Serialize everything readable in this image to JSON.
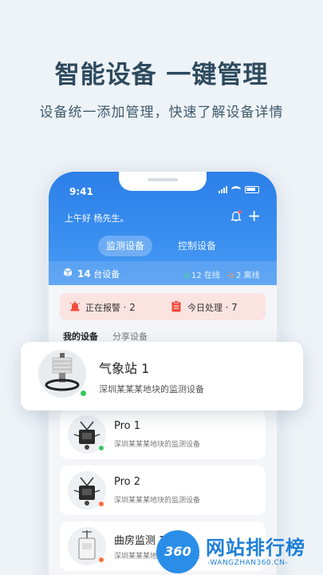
{
  "headline": "智能设备 一键管理",
  "subheadline": "设备统一添加管理，快速了解设备详情",
  "status_bar": {
    "time": "9:41"
  },
  "header": {
    "greeting": "上午好 杨先生。",
    "tabs": [
      {
        "label": "监测设备",
        "active": true
      },
      {
        "label": "控制设备",
        "active": false
      }
    ]
  },
  "stats": {
    "total_count": "14",
    "total_label": "台设备",
    "online": "12 在线",
    "offline": "2 离线"
  },
  "alert_bar": {
    "alarm_label": "正在报警",
    "alarm_count": "· 2",
    "today_label": "今日处理",
    "today_count": "· 7"
  },
  "device_tabs": [
    {
      "label": "我的设备",
      "active": true
    },
    {
      "label": "分享设备",
      "active": false
    }
  ],
  "featured_device": {
    "name": "气象站 1",
    "description": "深圳某某某地块的监测设备",
    "status": "online"
  },
  "devices": [
    {
      "name": "Pro 1",
      "description": "深圳某某某地块的监测设备",
      "status": "online"
    },
    {
      "name": "Pro 2",
      "description": "深圳某某某地块的监测设备",
      "status": "offline"
    },
    {
      "name": "曲房监测 1",
      "description": "深圳某某某地块的监测设备",
      "status": "offline"
    }
  ],
  "watermark": {
    "badge": "360",
    "title": "网站排行榜",
    "subtitle": "-WANGZHAN360.CN-"
  },
  "colors": {
    "primary": "#2d7fe8",
    "online": "#34c759",
    "offline": "#ff6b3d",
    "alert_bg": "#fbe3e1"
  }
}
